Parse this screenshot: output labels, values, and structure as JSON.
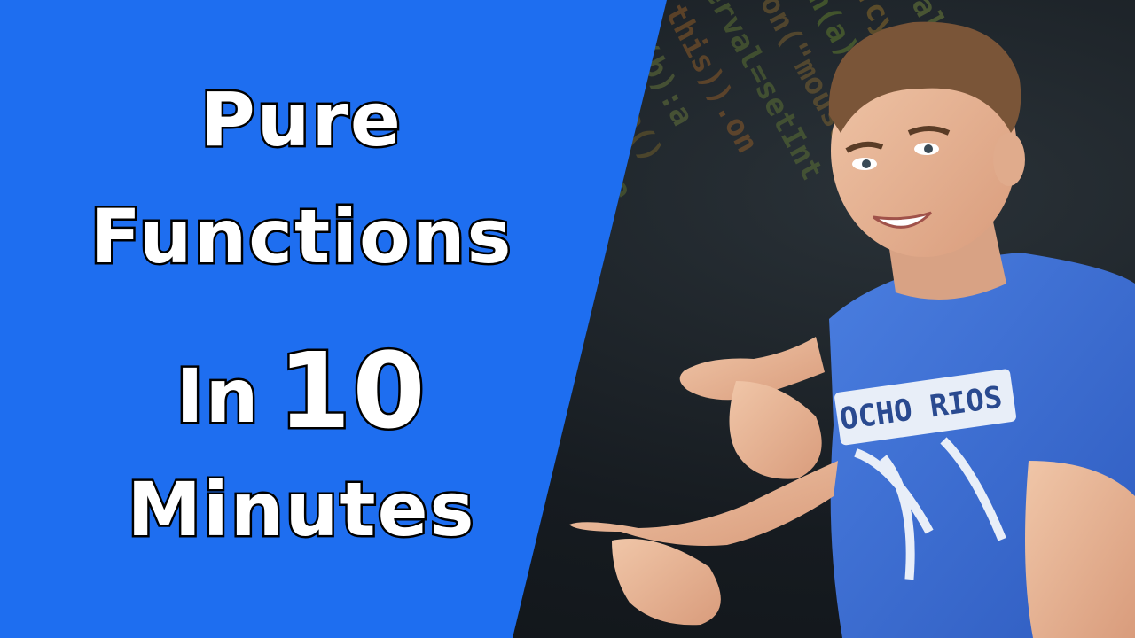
{
  "thumbnail": {
    "title_lines": {
      "line1": "Pure",
      "line2": "Functions",
      "line3_prefix": "In",
      "line3_number": "10",
      "line4": "Minutes"
    },
    "shirt_print": "OCHO RIOS",
    "colors": {
      "panel_blue": "#1e6ef0",
      "text_white": "#ffffff",
      "text_outline": "#000000",
      "shirt_blue": "#3c6ed8",
      "background_dark": "#141a1f"
    }
  }
}
